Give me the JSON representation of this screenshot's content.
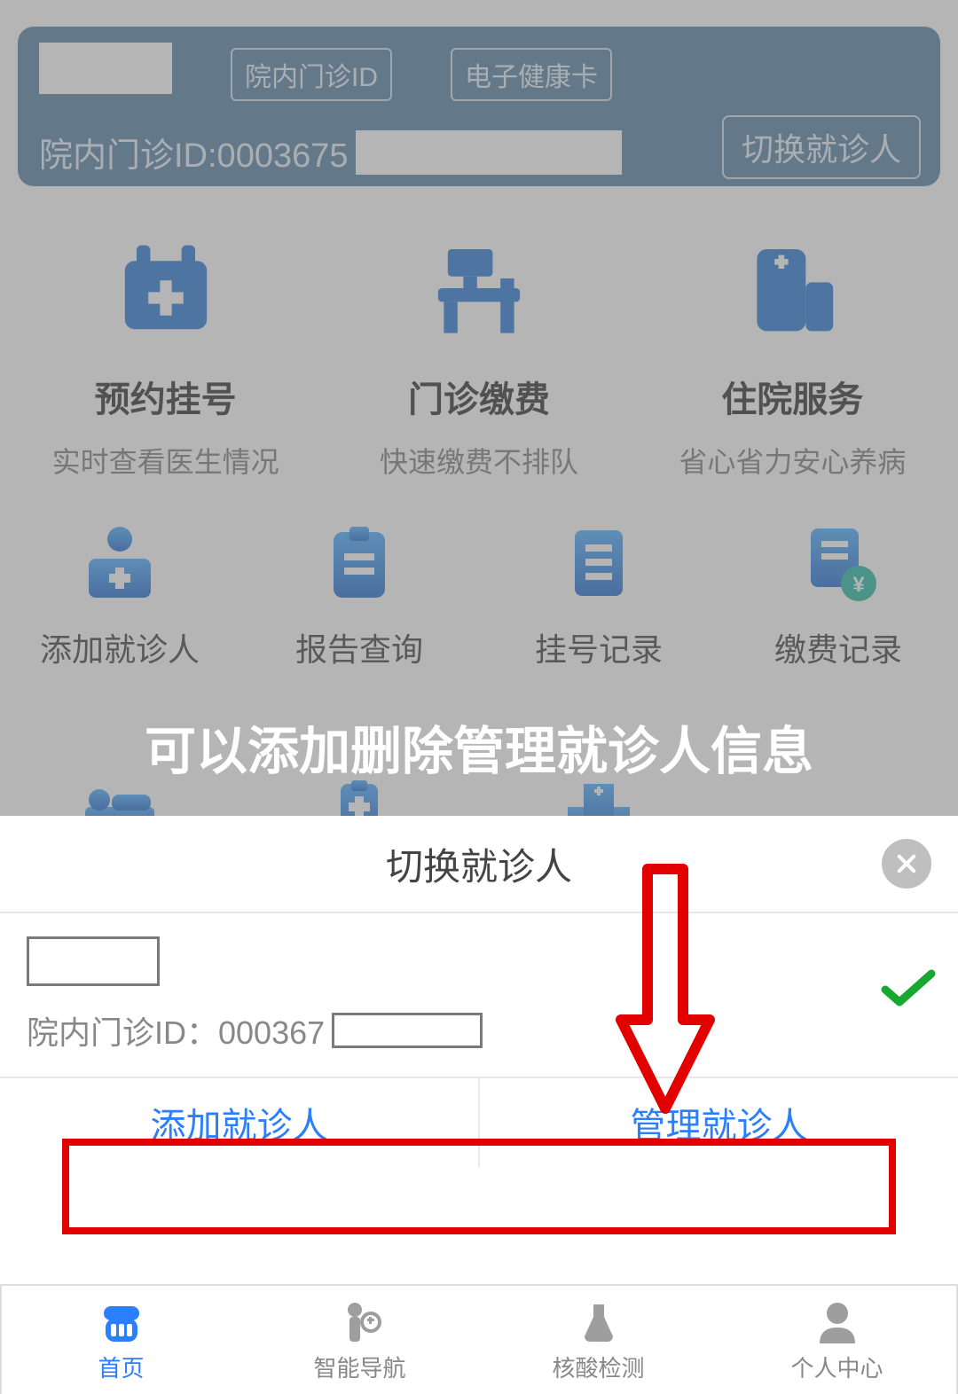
{
  "patientCard": {
    "tag1": "院内门诊ID",
    "tag2": "电子健康卡",
    "idLabel": "院内门诊ID:0003675",
    "switchLabel": "切换就诊人"
  },
  "services": [
    {
      "title": "预约挂号",
      "sub": "实时查看医生情况"
    },
    {
      "title": "门诊缴费",
      "sub": "快速缴费不排队"
    },
    {
      "title": "住院服务",
      "sub": "省心省力安心养病"
    }
  ],
  "grid": [
    {
      "title": "添加就诊人"
    },
    {
      "title": "报告查询"
    },
    {
      "title": "挂号记录"
    },
    {
      "title": "缴费记录"
    }
  ],
  "overlayText": "可以添加删除管理就诊人信息",
  "sheet": {
    "title": "切换就诊人",
    "idLabel": "院内门诊ID：000367",
    "addLabel": "添加就诊人",
    "manageLabel": "管理就诊人"
  },
  "tabs": [
    {
      "label": "首页"
    },
    {
      "label": "智能导航"
    },
    {
      "label": "核酸检测"
    },
    {
      "label": "个人中心"
    }
  ]
}
